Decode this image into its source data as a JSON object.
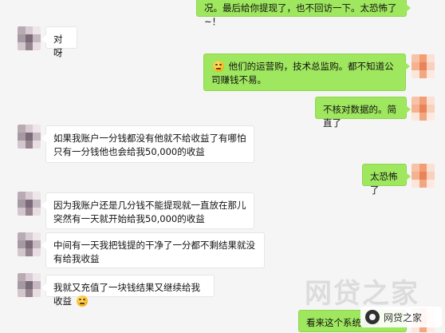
{
  "messages": [
    {
      "side": "right",
      "text": "况。最后给你提现了，也不回访一下。太恐怖了~！"
    },
    {
      "side": "left",
      "text": "对呀"
    },
    {
      "side": "right",
      "text": "他们的运营购，技术总监购。都不知道公司赚钱不易。",
      "emoji": "laugh-cry-emoji"
    },
    {
      "side": "right",
      "text": "不核对数据的。简直了"
    },
    {
      "side": "left",
      "text": "如果我账户一分钱都没有他就不给收益了有哪怕只有一分钱他也会给我50,000的收益"
    },
    {
      "side": "right",
      "text": "太恐怖了"
    },
    {
      "side": "left",
      "text": "因为我账户还是几分钱不能提现就一直放在那儿突然有一天就开始给我50,000的收益"
    },
    {
      "side": "left",
      "text": "中间有一天我把钱提的干净了一分都不剩结果就没有给我收益"
    },
    {
      "side": "left",
      "text": "我就又充值了一块钱结果又继续给我收益",
      "emoji": "laugh-cry-emoji"
    },
    {
      "side": "right",
      "text": "看来这个系统漏洞"
    }
  ],
  "watermark": {
    "main": "网贷之家",
    "badge": "网贷之家"
  },
  "colors": {
    "right_bubble": "#9fe75f",
    "left_bubble": "#ffffff",
    "background": "#f5f5f5"
  }
}
